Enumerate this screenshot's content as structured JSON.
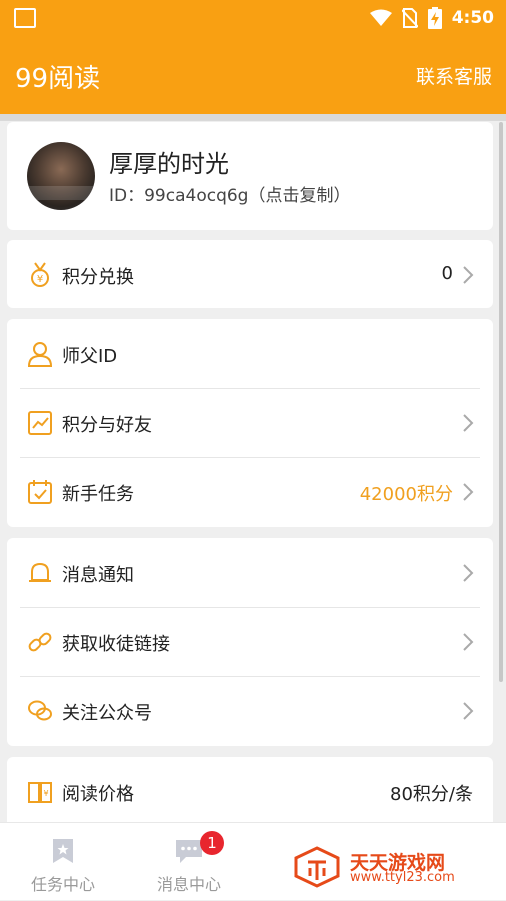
{
  "status_bar": {
    "time": "4:50"
  },
  "app_bar": {
    "title": "99阅读",
    "contact": "联系客服"
  },
  "profile": {
    "nickname": "厚厚的时光",
    "id_text": "ID：99ca4ocq6g（点击复制）"
  },
  "points_exchange": {
    "label": "积分兑换",
    "value": "0"
  },
  "group1": [
    {
      "label": "师父ID",
      "value": "",
      "icon": "user-icon"
    },
    {
      "label": "积分与好友",
      "value": "",
      "icon": "chart-icon"
    },
    {
      "label": "新手任务",
      "value": "42000积分",
      "icon": "calendar-icon"
    }
  ],
  "group2": [
    {
      "label": "消息通知",
      "icon": "bell-icon"
    },
    {
      "label": "获取收徒链接",
      "icon": "link-icon"
    },
    {
      "label": "关注公众号",
      "icon": "wechat-icon"
    }
  ],
  "read_price": {
    "label": "阅读价格",
    "value": "80积分/条",
    "icon": "book-icon"
  },
  "tabs": [
    {
      "label": "任务中心",
      "icon": "bookmark-icon"
    },
    {
      "label": "消息中心",
      "icon": "chat-icon",
      "badge": "1"
    }
  ],
  "watermark": {
    "title": "天天游戏网",
    "url": "www.ttyl23.com"
  },
  "colors": {
    "accent": "#f9a012",
    "icon": "#f0a020",
    "badge": "#e8262e"
  }
}
